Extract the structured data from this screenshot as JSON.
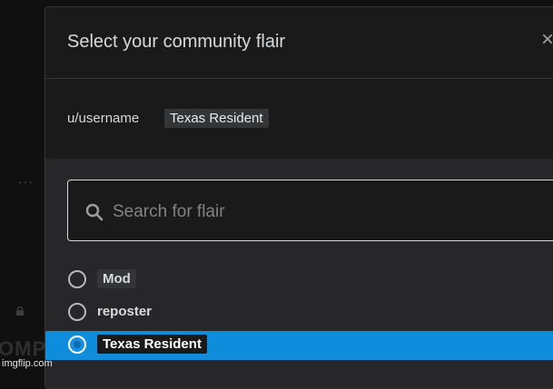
{
  "background": {
    "dots": "···",
    "partial_text": "OMP"
  },
  "modal": {
    "title": "Select your community flair",
    "close_label": "×"
  },
  "preview": {
    "username": "u/username",
    "flair": "Texas Resident"
  },
  "search": {
    "placeholder": "Search for flair",
    "value": ""
  },
  "flair_options": [
    {
      "label": "Mod",
      "selected": false,
      "style": "tag"
    },
    {
      "label": "reposter",
      "selected": false,
      "style": "plain"
    },
    {
      "label": "Texas Resident",
      "selected": true,
      "style": "tag"
    }
  ],
  "watermark": "imgflip.com",
  "colors": {
    "accent": "#0d8ddb",
    "modal_bg": "#1a1a1b",
    "panel_bg": "#272729"
  }
}
